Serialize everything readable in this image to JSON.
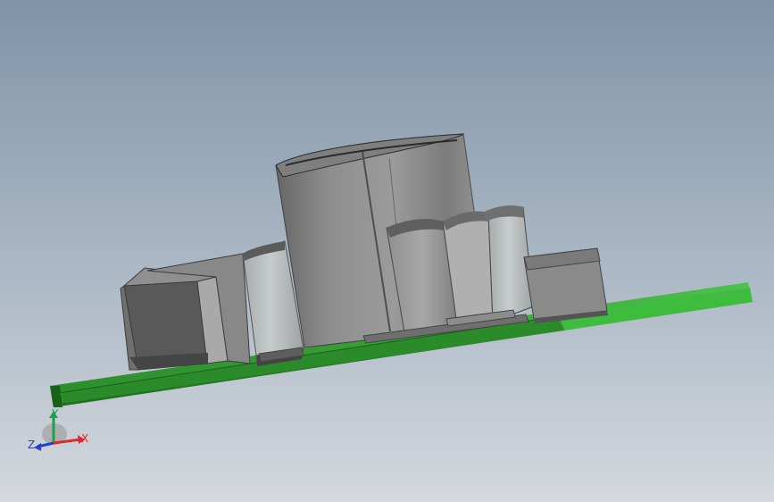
{
  "viewport": {
    "background_top": "#7f94a8",
    "background_bottom": "#d4d8de"
  },
  "triad": {
    "x_label": "X",
    "y_label": "Y",
    "z_label": "Z",
    "x_color": "#d92b2b",
    "y_color": "#17a34a",
    "z_color": "#2140d8"
  },
  "model": {
    "pcb_color": "#2f8f2f",
    "component_color": "#8d8d8d"
  }
}
